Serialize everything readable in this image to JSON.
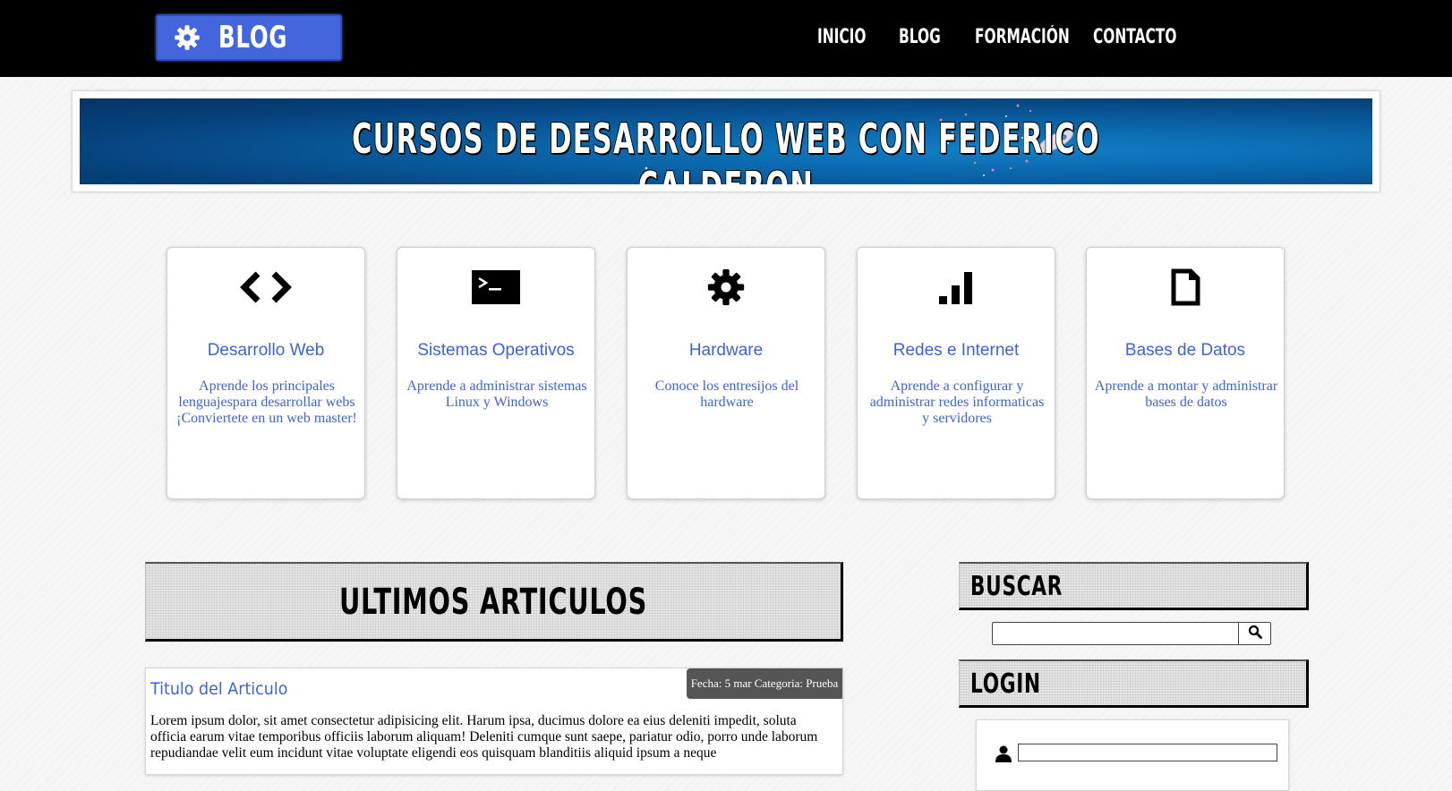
{
  "header": {
    "logo": {
      "label": "BLOG",
      "icon": "gear-icon"
    },
    "nav": [
      "INICIO",
      "BLOG",
      "FORMACIÓN",
      "CONTACTO"
    ]
  },
  "banner": {
    "text": "CURSOS DE DESARROLLO WEB CON FEDERICO CALDERON"
  },
  "categories": [
    {
      "icon": "code-icon",
      "title": "Desarrollo Web",
      "description": "Aprende los principales lenguajespara desarrollar webs ¡Conviertete en un web master!"
    },
    {
      "icon": "terminal-icon",
      "title": "Sistemas Operativos",
      "description": "Aprende a administrar sistemas Linux y Windows"
    },
    {
      "icon": "gear-icon",
      "title": "Hardware",
      "description": "Conoce los entresijos del hardware"
    },
    {
      "icon": "signal-icon",
      "title": "Redes e Internet",
      "description": "Aprende a configurar y administrar redes informaticas y servidores"
    },
    {
      "icon": "file-icon",
      "title": "Bases de Datos",
      "description": "Aprende a montar y administrar bases de datos"
    }
  ],
  "main": {
    "section_title": "ULTIMOS ARTICULOS",
    "article": {
      "title": "Titulo del Articulo",
      "meta": "Fecha: 5 mar Categoria: Prueba",
      "body": "Lorem ipsum dolor, sit amet consectetur adipisicing elit. Harum ipsa, ducimus dolore ea eius deleniti impedit, soluta officia earum vitae temporibus officiis laborum aliquam! Deleniti cumque sunt saepe, pariatur odio, porro unde laborum repudiandae velit eum incidunt vitae voluptate eligendi eos quisquam blanditiis aliquid ipsum a neque"
    }
  },
  "sidebar": {
    "search": {
      "title": "BUSCAR",
      "value": "",
      "icon": "search-icon"
    },
    "login": {
      "title": "LOGIN",
      "user_icon": "user-icon",
      "username_value": ""
    }
  },
  "colors": {
    "accent": "#3d63d8",
    "logo_bg": "#4466dd",
    "topbar": "#000000",
    "meta_bg": "#555555"
  }
}
